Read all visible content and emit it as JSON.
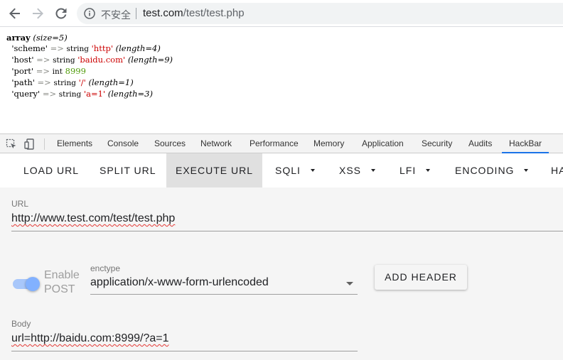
{
  "browser": {
    "security_label": "不安全",
    "url_host": "test.com",
    "url_path": "/test/test.php"
  },
  "page": {
    "dump": {
      "type_word": "array",
      "size_text": "(size=5)",
      "rows": [
        {
          "key": "'scheme'",
          "arrow": "=>",
          "type": "string",
          "value": "'http'",
          "meta": "(length=4)"
        },
        {
          "key": "'host'",
          "arrow": "=>",
          "type": "string",
          "value": "'baidu.com'",
          "meta": "(length=9)"
        },
        {
          "key": "'port'",
          "arrow": "=>",
          "type": "int",
          "value": "8999",
          "meta": ""
        },
        {
          "key": "'path'",
          "arrow": "=>",
          "type": "string",
          "value": "'/'",
          "meta": "(length=1)"
        },
        {
          "key": "'query'",
          "arrow": "=>",
          "type": "string",
          "value": "'a=1'",
          "meta": "(length=3)"
        }
      ]
    }
  },
  "devtools": {
    "tabs": [
      "Elements",
      "Console",
      "Sources",
      "Network",
      "Performance",
      "Memory",
      "Application",
      "Security",
      "Audits",
      "HackBar"
    ],
    "active_tab": "HackBar"
  },
  "hackbar": {
    "menu": {
      "load_url": "LOAD URL",
      "split_url": "SPLIT URL",
      "execute_url": "EXECUTE URL",
      "sqli": "SQLI",
      "xss": "XSS",
      "lfi": "LFI",
      "encoding": "ENCODING",
      "more": "HA"
    },
    "url_label": "URL",
    "url_value": "http://www.test.com/test/test.php",
    "enable_post_label": "Enable POST",
    "enable_post_on": true,
    "enctype_label": "enctype",
    "enctype_value": "application/x-www-form-urlencoded",
    "add_header_label": "ADD HEADER",
    "body_label": "Body",
    "body_value": "url=http://baidu.com:8999/?a=1"
  },
  "colors": {
    "accent": "#1a73e8",
    "toggle_on": "#82b1ff",
    "php_string": "#cc0000",
    "php_int": "#4e9a06"
  }
}
